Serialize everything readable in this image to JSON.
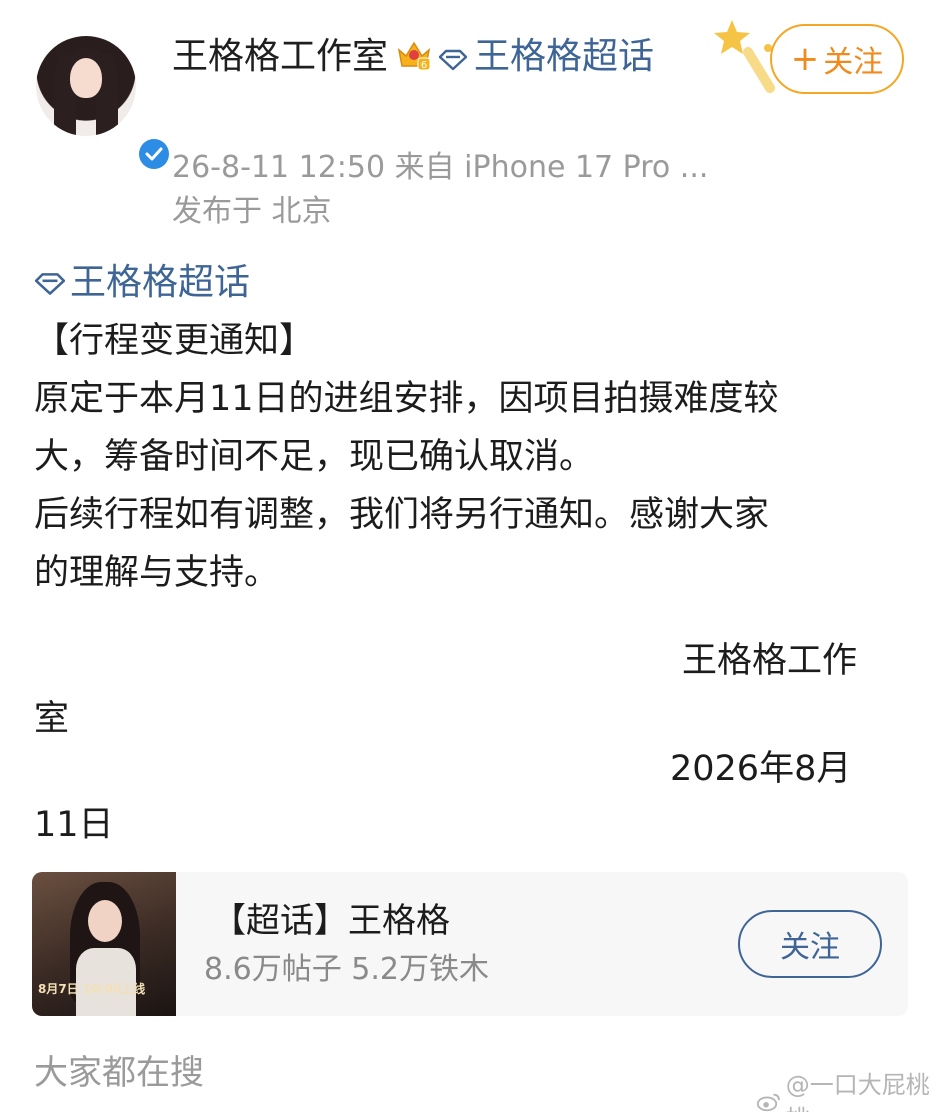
{
  "author": {
    "name": "王格格工作室",
    "topic_link": "王格格超话",
    "verified_icon": "verified-badge-icon",
    "crown_icon": "vip-crown-icon",
    "crown_level": "6"
  },
  "follow_button": {
    "label": "关注",
    "plus": "+"
  },
  "meta": {
    "time_source": "26-8-11 12:50  来自 iPhone 17 Pro ...",
    "location": "发布于 北京"
  },
  "post": {
    "topic_tag": "王格格超话",
    "heading": "【行程变更通知】",
    "line1": "原定于本月11日的进组安排，因项目拍摄难度较",
    "line2": "大，筹备时间不足，现已确认取消。",
    "line3": "后续行程如有调整，我们将另行通知。感谢大家",
    "line4": "的理解与支持。",
    "sign_1a": "王格格工作",
    "sign_1b": "室",
    "sign_2a": "2026年8月",
    "sign_2b": "11日"
  },
  "topic_card": {
    "title": "【超话】王格格",
    "stats": "8.6万帖子 5.2万铁木",
    "follow_label": "关注",
    "poster_date": "8月7日 10:00上线"
  },
  "section": {
    "search_label": "大家都在搜"
  },
  "watermark": {
    "text": "@一口大屁桃桃"
  },
  "colors": {
    "accent_link": "#3e6596",
    "follow_orange": "#f08a1c",
    "meta_gray": "#9a9a9a",
    "verified_blue": "#2d8ce3"
  }
}
